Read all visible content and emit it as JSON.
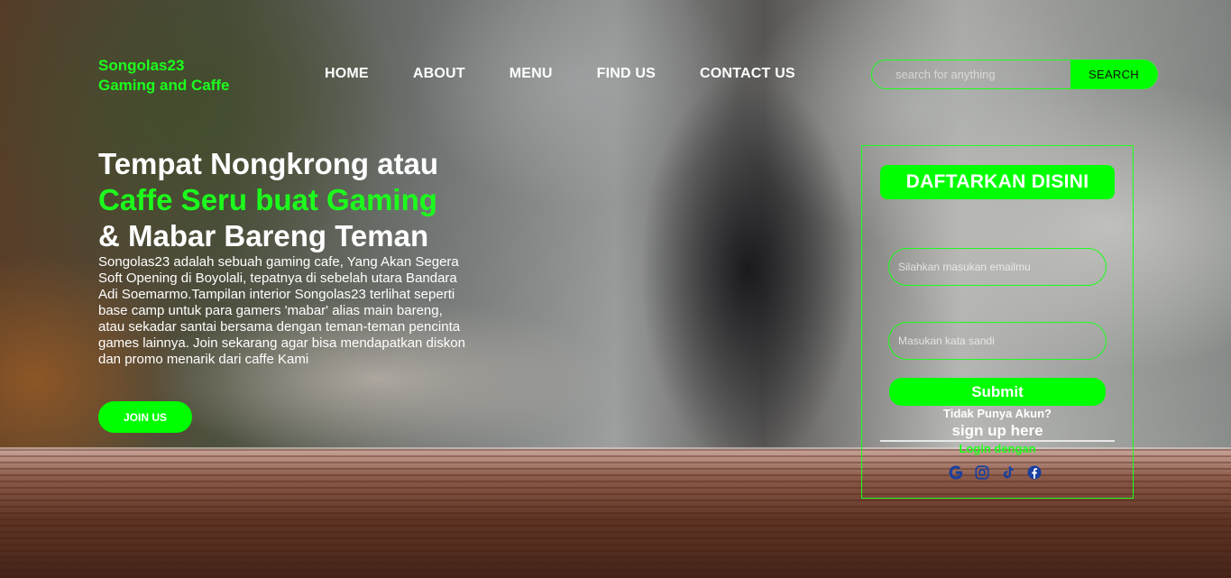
{
  "brand": {
    "line1": "Songolas23",
    "line2": "Gaming and Caffe"
  },
  "nav": {
    "items": [
      "HOME",
      "ABOUT",
      "MENU",
      "FIND US",
      "CONTACT US"
    ]
  },
  "search": {
    "placeholder": "search for anything",
    "button_label": "SEARCH"
  },
  "hero": {
    "title_line1": "Tempat Nongkrong atau",
    "title_line2": "Caffe Seru buat Gaming",
    "title_line3": "& Mabar Bareng Teman",
    "description": "Songolas23 adalah sebuah gaming cafe, Yang Akan Segera Soft Opening di Boyolali, tepatnya di sebelah utara Bandara Adi Soemarmo.Tampilan interior Songolas23 terlihat seperti base camp untuk para gamers 'mabar' alias main bareng, atau sekadar santai bersama dengan teman-teman pencinta games lainnya. Join sekarang agar bisa mendapatkan diskon dan promo menarik dari caffe Kami",
    "join_label": "JOIN US"
  },
  "register": {
    "title": "DAFTARKAN DISINI",
    "email_placeholder": "Silahkan masukan emailmu",
    "password_placeholder": "Masukan kata sandi",
    "submit_label": "Submit",
    "no_account": "Tidak Punya Akun?",
    "signup_label": "sign up here",
    "login_with": "Login dengan",
    "social_icons": [
      "google-icon",
      "instagram-icon",
      "tiktok-icon",
      "facebook-icon"
    ]
  },
  "colors": {
    "accent": "#00ff00",
    "social_icon": "#1a3fa0"
  }
}
